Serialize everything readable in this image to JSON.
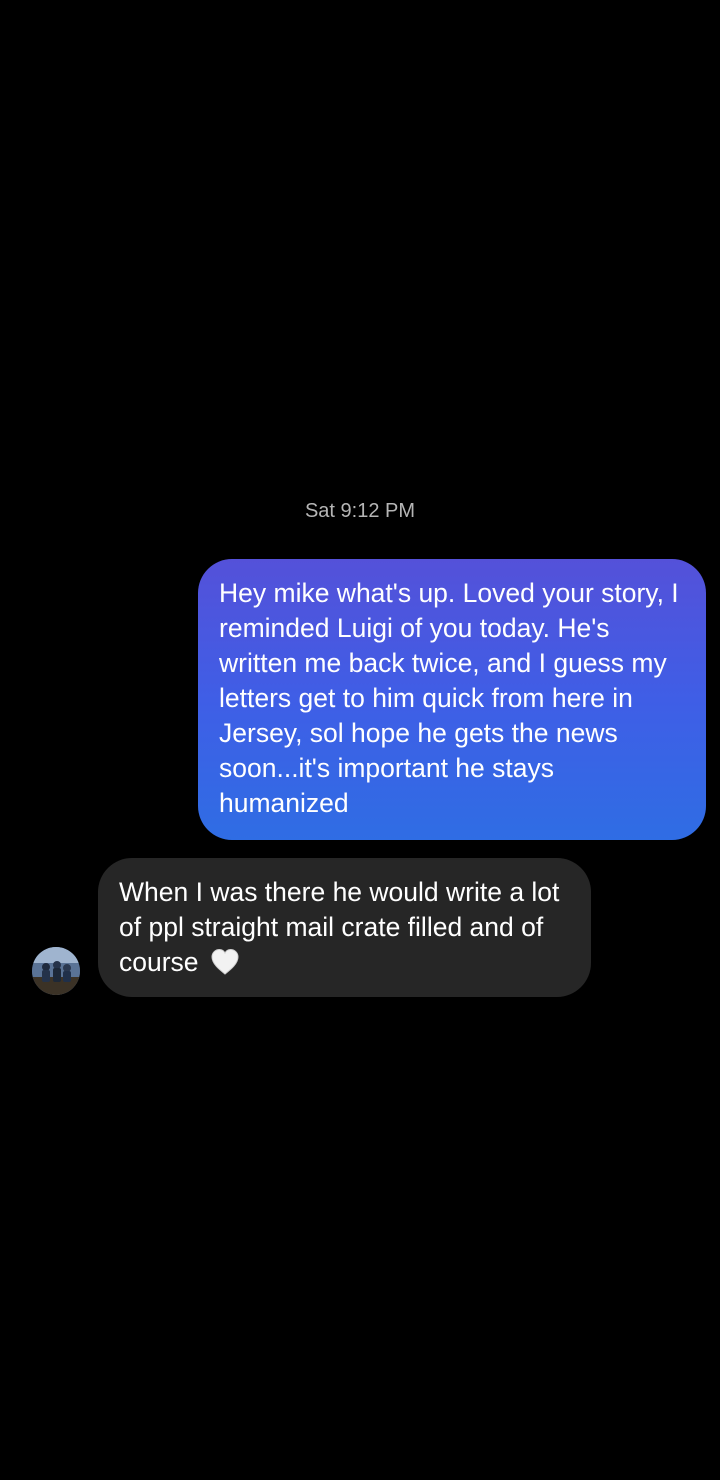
{
  "thread": {
    "timestamp": "Sat 9:12 PM",
    "messages": [
      {
        "direction": "outgoing",
        "text": "Hey mike what's up. Loved your story, I reminded Luigi of you today. He's written me back twice, and I guess my letters get to him quick from here in Jersey, sol hope he gets the news soon...it's important he stays humanized"
      },
      {
        "direction": "incoming",
        "text": "When I was there he would write a lot of ppl straight mail crate filled and of course",
        "emoji": "white-heart-icon"
      }
    ]
  },
  "colors": {
    "background": "#000000",
    "outgoing_bubble_top": "#5451d9",
    "outgoing_bubble_bottom": "#2f6de4",
    "incoming_bubble": "#262626",
    "timestamp_text": "#b5b5b5"
  }
}
